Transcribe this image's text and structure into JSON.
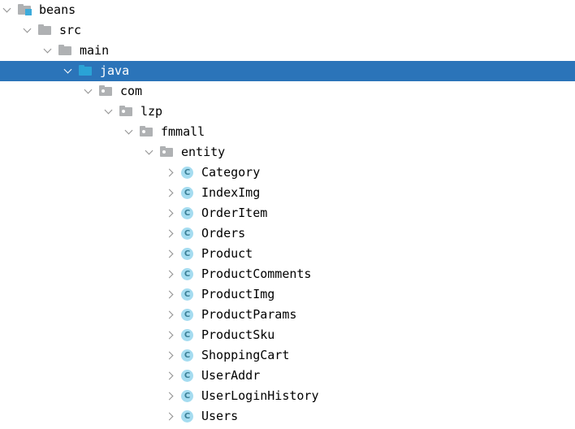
{
  "tree": {
    "selected_index": 3,
    "colors": {
      "selection": "#2b74b9",
      "selection_text": "#ffffff",
      "text": "#000000",
      "folder_gray": "#afb1b3",
      "source_root_blue": "#1d9fd4",
      "module_badge": "#3cabdb",
      "class_icon_bg": "#a5dcf0",
      "class_icon_letter": "#3a7f96",
      "chevron": "#8f8f8f",
      "background": "#ffffff"
    },
    "class_icon_letter": "C",
    "nodes": [
      {
        "label": "beans",
        "depth": 1,
        "icon": "module-folder-icon",
        "state": "expanded"
      },
      {
        "label": "src",
        "depth": 2,
        "icon": "folder-icon",
        "state": "expanded"
      },
      {
        "label": "main",
        "depth": 3,
        "icon": "folder-icon",
        "state": "expanded"
      },
      {
        "label": "java",
        "depth": 4,
        "icon": "source-root-folder-icon",
        "state": "expanded"
      },
      {
        "label": "com",
        "depth": 5,
        "icon": "package-icon",
        "state": "expanded"
      },
      {
        "label": "lzp",
        "depth": 6,
        "icon": "package-icon",
        "state": "expanded"
      },
      {
        "label": "fmmall",
        "depth": 7,
        "icon": "package-icon",
        "state": "expanded"
      },
      {
        "label": "entity",
        "depth": 8,
        "icon": "package-icon",
        "state": "expanded"
      },
      {
        "label": "Category",
        "depth": 9,
        "icon": "java-class-icon",
        "state": "collapsed"
      },
      {
        "label": "IndexImg",
        "depth": 9,
        "icon": "java-class-icon",
        "state": "collapsed"
      },
      {
        "label": "OrderItem",
        "depth": 9,
        "icon": "java-class-icon",
        "state": "collapsed"
      },
      {
        "label": "Orders",
        "depth": 9,
        "icon": "java-class-icon",
        "state": "collapsed"
      },
      {
        "label": "Product",
        "depth": 9,
        "icon": "java-class-icon",
        "state": "collapsed"
      },
      {
        "label": "ProductComments",
        "depth": 9,
        "icon": "java-class-icon",
        "state": "collapsed"
      },
      {
        "label": "ProductImg",
        "depth": 9,
        "icon": "java-class-icon",
        "state": "collapsed"
      },
      {
        "label": "ProductParams",
        "depth": 9,
        "icon": "java-class-icon",
        "state": "collapsed"
      },
      {
        "label": "ProductSku",
        "depth": 9,
        "icon": "java-class-icon",
        "state": "collapsed"
      },
      {
        "label": "ShoppingCart",
        "depth": 9,
        "icon": "java-class-icon",
        "state": "collapsed"
      },
      {
        "label": "UserAddr",
        "depth": 9,
        "icon": "java-class-icon",
        "state": "collapsed"
      },
      {
        "label": "UserLoginHistory",
        "depth": 9,
        "icon": "java-class-icon",
        "state": "collapsed"
      },
      {
        "label": "Users",
        "depth": 9,
        "icon": "java-class-icon",
        "state": "collapsed"
      }
    ]
  }
}
